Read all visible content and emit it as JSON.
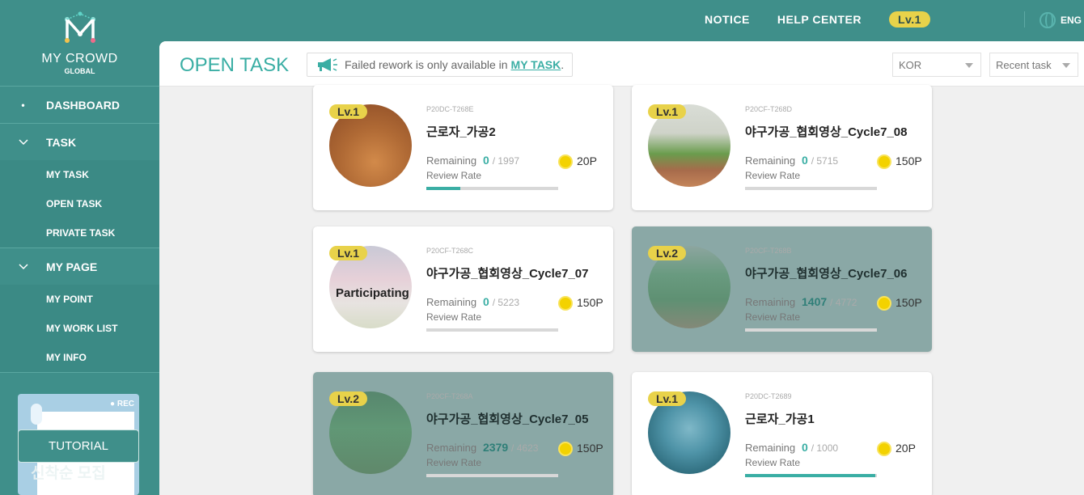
{
  "app": {
    "name": "MY CROWD",
    "sub": "GLOBAL"
  },
  "topnav": {
    "notice": "NOTICE",
    "help": "HELP CENTER",
    "level": "Lv.1",
    "lang": "ENG"
  },
  "sidebar": {
    "dashboard": "DASHBOARD",
    "task": "TASK",
    "task_items": [
      "MY TASK",
      "OPEN TASK",
      "PRIVATE TASK"
    ],
    "my_page": "MY PAGE",
    "my_page_items": [
      "MY POINT",
      "MY WORK LIST",
      "MY INFO"
    ],
    "tutorial_rec": "REC",
    "tutorial": "TUTORIAL",
    "tutorial_ghost": "신착순 모집"
  },
  "header": {
    "title": "OPEN TASK",
    "notice_text": "Failed rework is only available in",
    "notice_link": "MY TASK",
    "notice_end": ".",
    "lang_select": "KOR",
    "sort_select": "Recent task"
  },
  "cards": [
    {
      "level": "Lv.1",
      "code": "P20DC-T268E",
      "title": "근로자_가공2",
      "remaining_label": "Remaining",
      "remaining": "0",
      "total": "/ 1997",
      "review_label": "Review Rate",
      "review_rate": 0.26,
      "points": "20P",
      "participating": "",
      "dim": false
    },
    {
      "level": "Lv.1",
      "code": "P20CF-T268D",
      "title": "야구가공_협회영상_Cycle7_08",
      "remaining_label": "Remaining",
      "remaining": "0",
      "total": "/ 5715",
      "review_label": "Review Rate",
      "review_rate": 0,
      "points": "150P",
      "participating": "",
      "dim": false
    },
    {
      "level": "Lv.1",
      "code": "P20CF-T268C",
      "title": "야구가공_협회영상_Cycle7_07",
      "remaining_label": "Remaining",
      "remaining": "0",
      "total": "/ 5223",
      "review_label": "Review Rate",
      "review_rate": 0,
      "points": "150P",
      "participating": "Participating",
      "dim": false
    },
    {
      "level": "Lv.2",
      "code": "P20CF-T268B",
      "title": "야구가공_협회영상_Cycle7_06",
      "remaining_label": "Remaining",
      "remaining": "1407",
      "total": "/ 4772",
      "review_label": "Review Rate",
      "review_rate": 0,
      "points": "150P",
      "participating": "",
      "dim": true
    },
    {
      "level": "Lv.2",
      "code": "P20CF-T268A",
      "title": "야구가공_협회영상_Cycle7_05",
      "remaining_label": "Remaining",
      "remaining": "2379",
      "total": "/ 4623",
      "review_label": "Review Rate",
      "review_rate": 0,
      "points": "150P",
      "participating": "",
      "dim": true
    },
    {
      "level": "Lv.1",
      "code": "P20DC-T2689",
      "title": "근로자_가공1",
      "remaining_label": "Remaining",
      "remaining": "0",
      "total": "/ 1000",
      "review_label": "Review Rate",
      "review_rate": 0.99,
      "points": "20P",
      "participating": "",
      "dim": false
    }
  ]
}
